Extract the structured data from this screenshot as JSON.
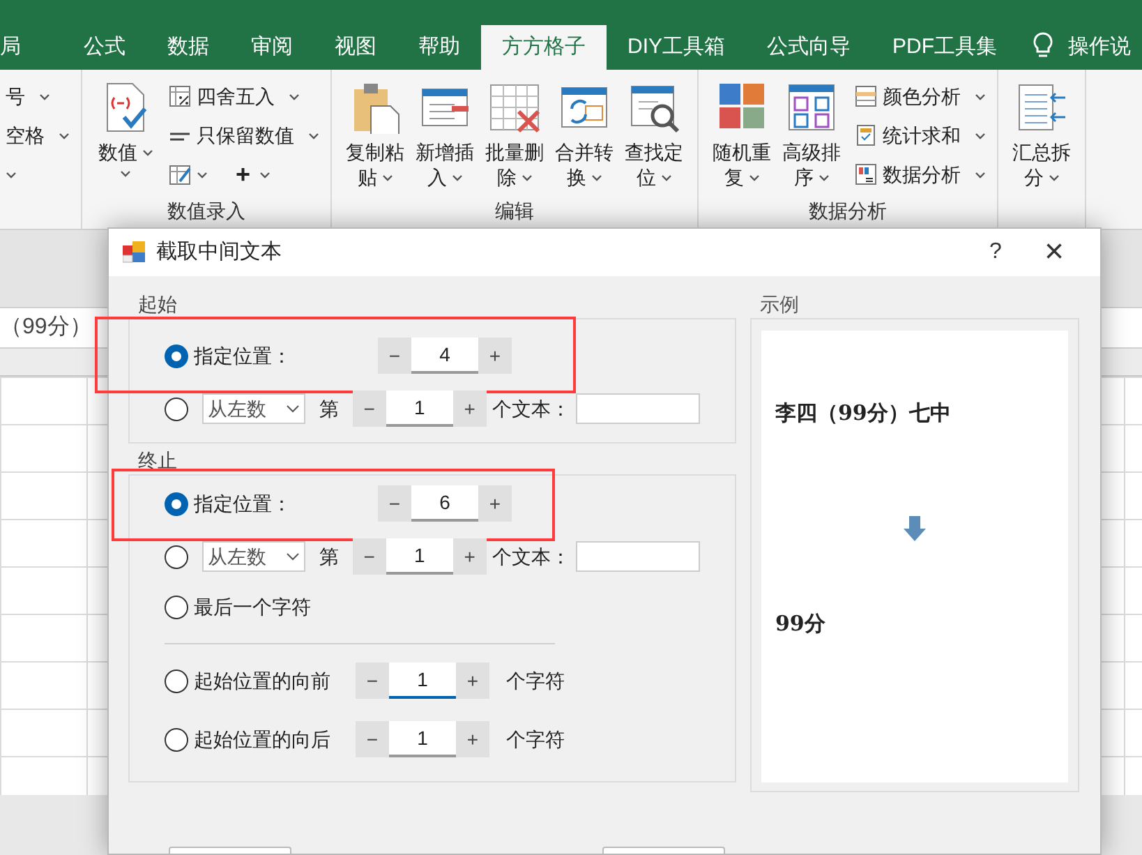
{
  "ribbon_tabs": [
    {
      "label": "局",
      "selected": false
    },
    {
      "label": "公式",
      "selected": false
    },
    {
      "label": "数据",
      "selected": false
    },
    {
      "label": "审阅",
      "selected": false
    },
    {
      "label": "视图",
      "selected": false
    },
    {
      "label": "帮助",
      "selected": false
    },
    {
      "label": "方方格子",
      "selected": true
    },
    {
      "label": "DIY工具箱",
      "selected": false
    },
    {
      "label": "公式向导",
      "selected": false
    },
    {
      "label": "PDF工具集",
      "selected": false
    }
  ],
  "tell_me": "操作说",
  "ribbon_groups": [
    {
      "items": [
        {
          "kind": "small",
          "label": "号"
        },
        {
          "kind": "small",
          "label": "空格"
        },
        {
          "kind": "caret"
        }
      ]
    },
    {
      "label": "数值录入",
      "items": [
        {
          "kind": "big",
          "lines": [
            "数值"
          ]
        },
        {
          "kind": "small",
          "label": "四舍五入"
        },
        {
          "kind": "small",
          "label": "只保留数值"
        },
        {
          "kind": "tools",
          "label": "+"
        }
      ]
    },
    {
      "label": "编辑",
      "items": [
        {
          "kind": "big",
          "lines": [
            "复制粘",
            "贴"
          ]
        },
        {
          "kind": "big",
          "lines": [
            "新增插",
            "入"
          ]
        },
        {
          "kind": "big",
          "lines": [
            "批量删",
            "除"
          ]
        },
        {
          "kind": "big",
          "lines": [
            "合并转",
            "换"
          ]
        },
        {
          "kind": "big",
          "lines": [
            "查找定",
            "位"
          ]
        }
      ]
    },
    {
      "label": "数据分析",
      "items": [
        {
          "kind": "big",
          "lines": [
            "随机重",
            "复"
          ]
        },
        {
          "kind": "big",
          "lines": [
            "高级排",
            "序"
          ]
        },
        {
          "kind": "small",
          "label": "颜色分析"
        },
        {
          "kind": "small",
          "label": "统计求和"
        },
        {
          "kind": "small",
          "label": "数据分析"
        }
      ]
    },
    {
      "items": [
        {
          "kind": "big",
          "lines": [
            "汇总拆",
            "分"
          ]
        }
      ]
    }
  ],
  "formula_bar": {
    "text": "（99分）"
  },
  "dialog": {
    "title": "截取中间文本",
    "help": "?",
    "close": "×",
    "groups": [
      {
        "legend": "起始",
        "rows": [
          {
            "kind": "position",
            "selected": true,
            "highlighted": true,
            "label": "指定位置：",
            "minus": "−",
            "value": "4",
            "plus": "+"
          },
          {
            "kind": "count",
            "selected": false,
            "dropdown": "从左数",
            "prefix": "第",
            "minus": "−",
            "value": "1",
            "plus": "+",
            "suffix": "个文本："
          }
        ]
      },
      {
        "legend": "终止",
        "rows": [
          {
            "kind": "position",
            "selected": true,
            "highlighted": true,
            "label": "指定位置：",
            "minus": "−",
            "value": "6",
            "plus": "+"
          },
          {
            "kind": "count",
            "selected": false,
            "dropdown": "从左数",
            "prefix": "第",
            "minus": "−",
            "value": "1",
            "plus": "+",
            "suffix": "个文本："
          },
          {
            "kind": "plain",
            "selected": false,
            "label": "最后一个字符"
          },
          {
            "kind": "divider"
          },
          {
            "kind": "offset",
            "selected": false,
            "focused": true,
            "label": "起始位置的向前",
            "minus": "−",
            "value": "1",
            "plus": "+",
            "suffix": "个字符"
          },
          {
            "kind": "offset",
            "selected": false,
            "focused": false,
            "label": "起始位置的向后",
            "minus": "−",
            "value": "1",
            "plus": "+",
            "suffix": "个字符"
          }
        ]
      }
    ],
    "example": {
      "legend": "示例",
      "source": "李四（99分）七中",
      "result": "99分"
    }
  }
}
